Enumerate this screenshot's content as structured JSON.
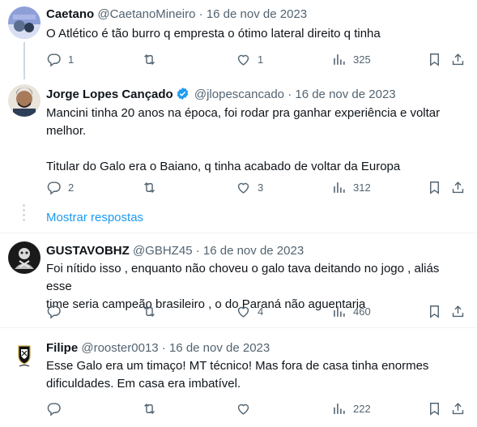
{
  "tweets": [
    {
      "name": "Caetano",
      "handle": "@CaetanoMineiro",
      "sep": "·",
      "date": "16 de nov de 2023",
      "verified": false,
      "lines": [
        "O Atlético é tão burro q empresta o ótimo lateral direito q tinha"
      ],
      "replies": "1",
      "retweets": "",
      "likes": "1",
      "views": "325"
    },
    {
      "name": "Jorge Lopes Cançado",
      "handle": "@jlopescancado",
      "sep": "·",
      "date": "16 de nov de 2023",
      "verified": true,
      "lines": [
        "Mancini tinha 20 anos na época, foi rodar pra ganhar experiência e voltar",
        "melhor.",
        "",
        "Titular do Galo era o Baiano, q tinha acabado de voltar da Europa"
      ],
      "replies": "2",
      "retweets": "",
      "likes": "3",
      "views": "312"
    },
    {
      "name": "GUSTAVOBHZ",
      "handle": "@GBHZ45",
      "sep": "·",
      "date": "16 de nov de 2023",
      "verified": false,
      "lines": [
        "Foi nítido isso , enquanto não choveu o galo tava deitando no jogo , aliás esse",
        "time seria campeão brasileiro , o do Paraná não aguentaria"
      ],
      "replies": "",
      "retweets": "",
      "likes": "4",
      "views": "460"
    },
    {
      "name": "Filipe",
      "handle": "@rooster0013",
      "sep": "·",
      "date": "16 de nov de 2023",
      "verified": false,
      "lines": [
        "Esse Galo era um timaço! MT técnico! Mas fora de casa tinha enormes",
        "dificuldades. Em casa era imbatível."
      ],
      "replies": "",
      "retweets": "",
      "likes": "",
      "views": "222"
    }
  ],
  "show_replies": "Mostrar respostas",
  "colors": {
    "text": "#0f1419",
    "secondary": "#536471",
    "link": "#1d9bf0",
    "verified": "#1d9bf0",
    "line": "#cfd9de"
  },
  "icons": [
    "reply-icon",
    "retweet-icon",
    "like-icon",
    "views-icon",
    "bookmark-icon",
    "share-icon",
    "verified-badge-icon"
  ]
}
